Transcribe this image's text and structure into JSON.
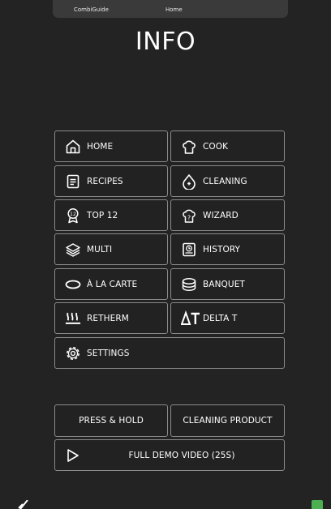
{
  "topbar": {
    "app_name": "CombiGuide",
    "crumb": "Home"
  },
  "page": {
    "title": "INFO"
  },
  "menu": {
    "home": "HOME",
    "cook": "COOK",
    "recipes": "RECIPES",
    "cleaning": "CLEANING",
    "top12": "TOP 12",
    "top12_badge": "12",
    "wizard": "WIZARD",
    "multi": "MULTI",
    "history": "HISTORY",
    "a_la_carte": "À LA CARTE",
    "banquet": "BANQUET",
    "retherm": "RETHERM",
    "delta_t": "DELTA T",
    "settings": "SETTINGS"
  },
  "extras": {
    "press_hold": "PRESS & HOLD",
    "cleaning_product": "CLEANING PRODUCT",
    "demo_video": "FULL DEMO VIDEO (25S)"
  },
  "icons": {
    "home": "home-icon",
    "cook": "chef-hat-icon",
    "recipes": "document-icon",
    "cleaning": "droplet-icon",
    "top12": "award-badge-icon",
    "wizard": "chef-hat-question-icon",
    "multi": "layers-icon",
    "history": "history-icon",
    "a_la_carte": "plate-icon",
    "banquet": "stacked-plates-icon",
    "retherm": "heat-waves-icon",
    "delta_t": "delta-icon",
    "settings": "gear-icon",
    "play": "play-icon",
    "back": "check-icon"
  },
  "colors": {
    "background": "#232323",
    "border": "#8a8a8a",
    "topbar": "#3a3a3a",
    "status_green": "#4caf50"
  }
}
